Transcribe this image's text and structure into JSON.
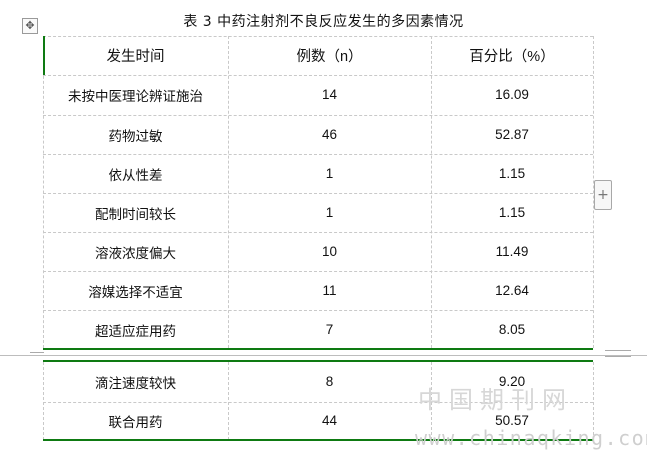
{
  "caption": "表 3  中药注射剂不良反应发生的多因素情况",
  "table": {
    "headers": [
      "发生时间",
      "例数（n）",
      "百分比（%）"
    ],
    "rows": [
      {
        "factor": "未按中医理论辨证施治",
        "count": "14",
        "percent": "16.09"
      },
      {
        "factor": "药物过敏",
        "count": "46",
        "percent": "52.87"
      },
      {
        "factor": "依从性差",
        "count": "1",
        "percent": "1.15"
      },
      {
        "factor": "配制时间较长",
        "count": "1",
        "percent": "1.15"
      },
      {
        "factor": "溶液浓度偏大",
        "count": "10",
        "percent": "11.49"
      },
      {
        "factor": "溶媒选择不适宜",
        "count": "11",
        "percent": "12.64"
      },
      {
        "factor": "超适应症用药",
        "count": "7",
        "percent": "8.05"
      },
      {
        "factor": "滴注速度较快",
        "count": "8",
        "percent": "9.20"
      },
      {
        "factor": "联合用药",
        "count": "44",
        "percent": "50.57"
      }
    ]
  },
  "controls": {
    "move_handle_glyph": "✥",
    "add_row_glyph": "+"
  },
  "watermark": {
    "chinese": "中国期刊网",
    "url": "www.chinaqking.com"
  },
  "colors": {
    "rule_green": "#0e7a12",
    "gridline": "#c9c9c9",
    "watermark": "#d7d7d7"
  }
}
